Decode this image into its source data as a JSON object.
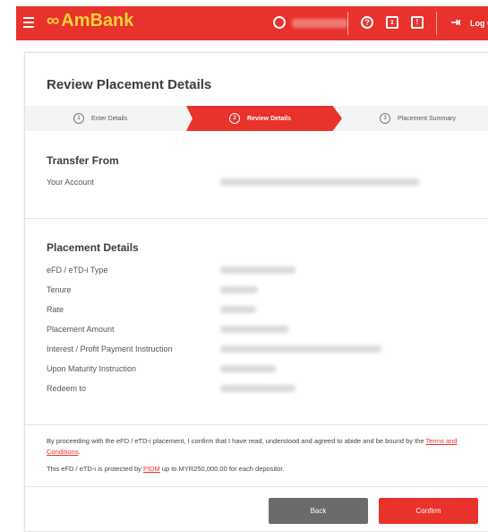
{
  "header": {
    "brand": "AmBank",
    "logout_label": "Log O"
  },
  "page": {
    "title": "Review Placement Details"
  },
  "stepper": {
    "steps": [
      {
        "num": "1",
        "label": "Enter Details"
      },
      {
        "num": "2",
        "label": "Review Details"
      },
      {
        "num": "3",
        "label": "Placement Summary"
      }
    ]
  },
  "transfer_from": {
    "title": "Transfer From",
    "rows": [
      {
        "label": "Your Account"
      }
    ]
  },
  "placement_details": {
    "title": "Placement Details",
    "rows": [
      {
        "label": "eFD / eTD-i Type"
      },
      {
        "label": "Tenure"
      },
      {
        "label": "Rate"
      },
      {
        "label": "Placement Amount"
      },
      {
        "label": "Interest / Profit Payment Instruction"
      },
      {
        "label": "Upon Maturity Instruction"
      },
      {
        "label": "Redeem to"
      }
    ]
  },
  "disclaimer": {
    "line1": "By proceeding with the eFD / eTD-i placement, I confirm that I have read, understood and agreed to abide and be bound by the ",
    "terms_link": "Terms and Conditions",
    "line1_end": ".",
    "line2_pre": "This eFD / eTD-i is protected by ",
    "pidm_link": "PIDM",
    "line2_post": " up to MYR250,000.00 for each depositor."
  },
  "buttons": {
    "back": "Back",
    "confirm": "Confirm"
  },
  "colors": {
    "brand_red": "#e8322b",
    "logo_yellow": "#fbd33b",
    "back_grey": "#6b6b6b"
  }
}
